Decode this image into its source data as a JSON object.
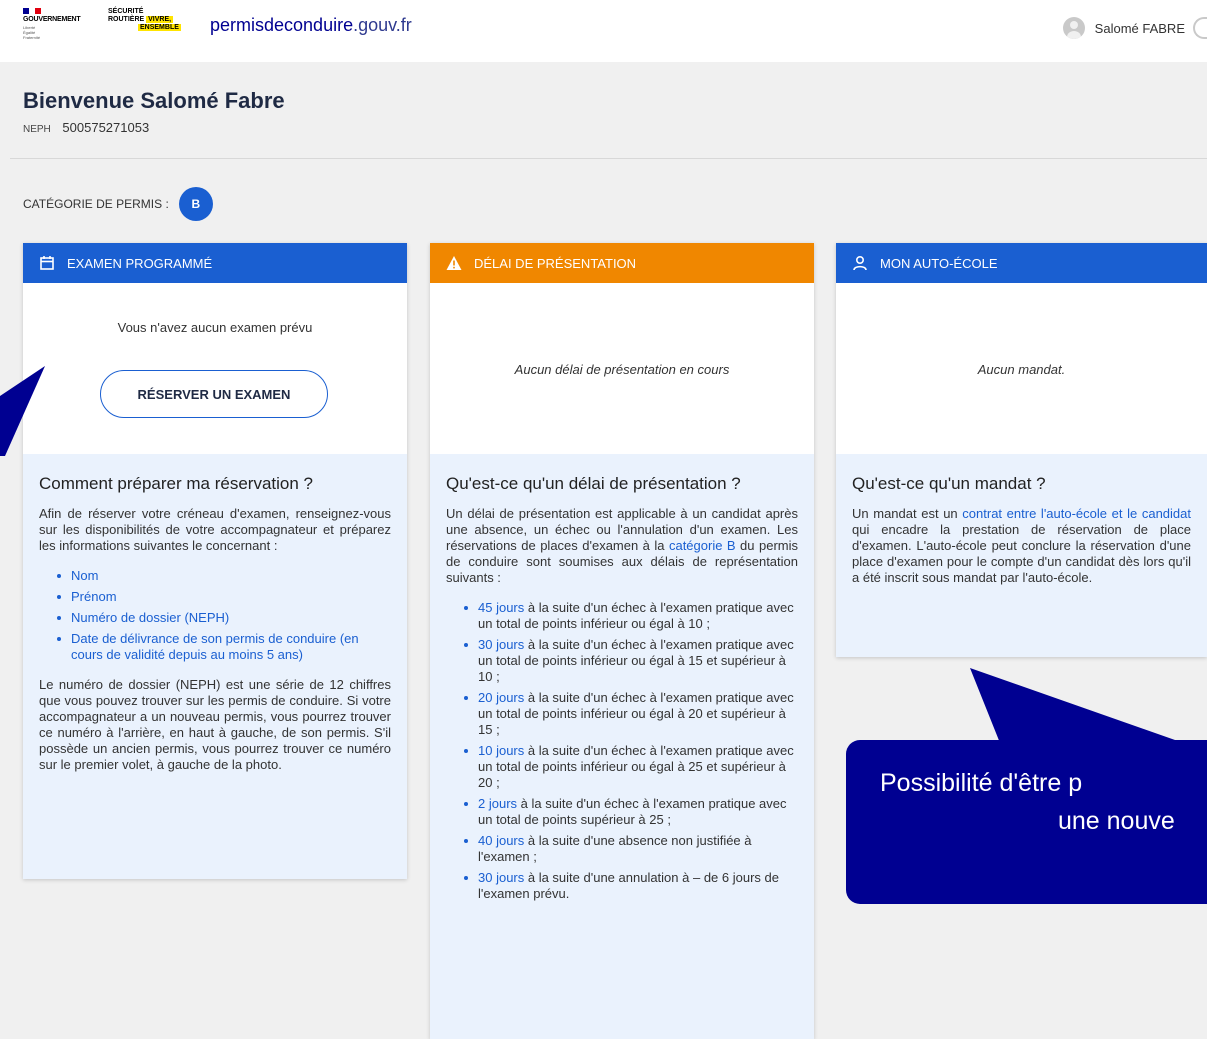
{
  "header": {
    "gov_label": "GOUVERNEMENT",
    "gov_motto": [
      "Liberté",
      "Égalité",
      "Fraternité"
    ],
    "sr_line1": "SÉCURITÉ",
    "sr_line2a": "ROUTIÈRE",
    "sr_line2b": "VIVRE,",
    "sr_line3": "ENSEMBLE",
    "site_name_bold": "permisdeconduire",
    "site_name_suffix": ".gouv.fr",
    "user_name": "Salomé FABRE"
  },
  "welcome": {
    "title": "Bienvenue Salomé Fabre",
    "neph_label": "NEPH",
    "neph_value": "500575271053",
    "permis_label": "CATÉGORIE DE PERMIS :",
    "permis_category": "B"
  },
  "cards": {
    "exam": {
      "header": "EXAMEN PROGRAMMÉ",
      "no_exam": "Vous n'avez aucun examen prévu",
      "button": "RÉSERVER UN EXAMEN",
      "info_title": "Comment préparer ma réservation ?",
      "intro": "Afin de réserver votre créneau d'examen, renseignez-vous sur les disponibilités de votre accompagnateur et préparez les informations suivantes le concernant :",
      "items": [
        "Nom",
        "Prénom",
        "Numéro de dossier (NEPH)",
        "Date de délivrance de son permis de conduire (en cours de validité depuis au moins 5 ans)"
      ],
      "outro": "Le numéro de dossier (NEPH) est une série de 12 chiffres que vous pouvez trouver sur les permis de conduire. Si votre accompagnateur a un nouveau permis, vous pourrez trouver ce numéro à l'arrière, en haut à gauche, de son permis. S'il possède un ancien permis, vous pourrez trouver ce numéro sur le premier volet, à gauche de la photo."
    },
    "delai": {
      "header": "DÉLAI DE PRÉSENTATION",
      "empty": "Aucun délai de présentation en cours",
      "info_title": "Qu'est-ce qu'un délai de présentation ?",
      "intro_a": "Un délai de présentation est applicable à un candidat après une absence, un échec ou l'annulation d'un examen. Les réservations de places d'examen à la ",
      "intro_link": "catégorie B",
      "intro_b": " du permis de conduire sont soumises aux délais de représentation suivants :",
      "items": [
        {
          "days": "45 jours",
          "text": " à la suite d'un échec à l'examen pratique avec un total de points inférieur ou égal à 10 ;"
        },
        {
          "days": "30 jours",
          "text": " à la suite d'un échec à l'examen pratique avec un total de points inférieur ou égal à 15 et supérieur à 10 ;"
        },
        {
          "days": "20 jours",
          "text": " à la suite d'un échec à l'examen pratique avec un total de points inférieur ou égal à 20 et supérieur à 15 ;"
        },
        {
          "days": "10 jours",
          "text": " à la suite d'un échec à l'examen pratique avec un total de points inférieur ou égal à 25 et supérieur à 20 ;"
        },
        {
          "days": "2 jours",
          "text": " à la suite d'un échec à l'examen pratique avec un total de points supérieur à 25 ;"
        },
        {
          "days": "40 jours",
          "text": " à la suite d'une absence non justifiée à l'examen ;"
        },
        {
          "days": "30 jours",
          "text": " à la suite d'une annulation à – de 6 jours de l'examen prévu."
        }
      ]
    },
    "auto_ecole": {
      "header": "MON AUTO-ÉCOLE",
      "empty": "Aucun mandat.",
      "info_title": "Qu'est-ce qu'un mandat ?",
      "text_a": "Un mandat est un ",
      "text_link": "contrat entre l'auto-école et le candidat",
      "text_b": " qui encadre la prestation de réservation de place d'examen. L'auto-école peut conclure la réservation d'une place d'examen pour le compte d'un candidat dès lors qu'il a été inscrit sous mandat par l'auto-école."
    }
  },
  "annotation": {
    "line1": "Possibilité d'être p",
    "line2": "une nouve"
  },
  "colors": {
    "primary": "#1a5fd1",
    "warning": "#f08700",
    "callout": "#000091"
  }
}
